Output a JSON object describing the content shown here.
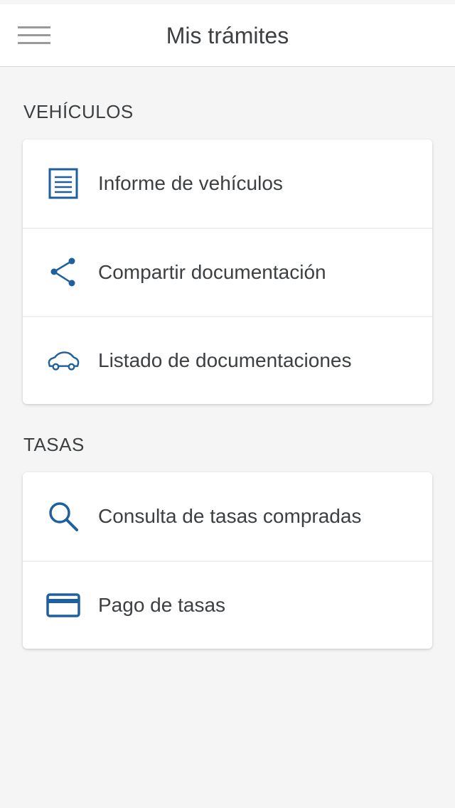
{
  "theme": {
    "accent": "#1f5f9e",
    "background": "#f5f5f5",
    "card_background": "#ffffff",
    "text": "#3c4043"
  },
  "header": {
    "menu_icon": "hamburger-menu-icon",
    "title": "Mis trámites"
  },
  "sections": [
    {
      "label": "VEHÍCULOS",
      "items": [
        {
          "icon": "document-list-icon",
          "label": "Informe de vehículos"
        },
        {
          "icon": "share-icon",
          "label": "Compartir documentación"
        },
        {
          "icon": "car-icon",
          "label": "Listado de documentaciones"
        }
      ]
    },
    {
      "label": "TASAS",
      "items": [
        {
          "icon": "search-icon",
          "label": "Consulta de tasas compradas"
        },
        {
          "icon": "credit-card-icon",
          "label": "Pago de tasas"
        }
      ]
    }
  ]
}
